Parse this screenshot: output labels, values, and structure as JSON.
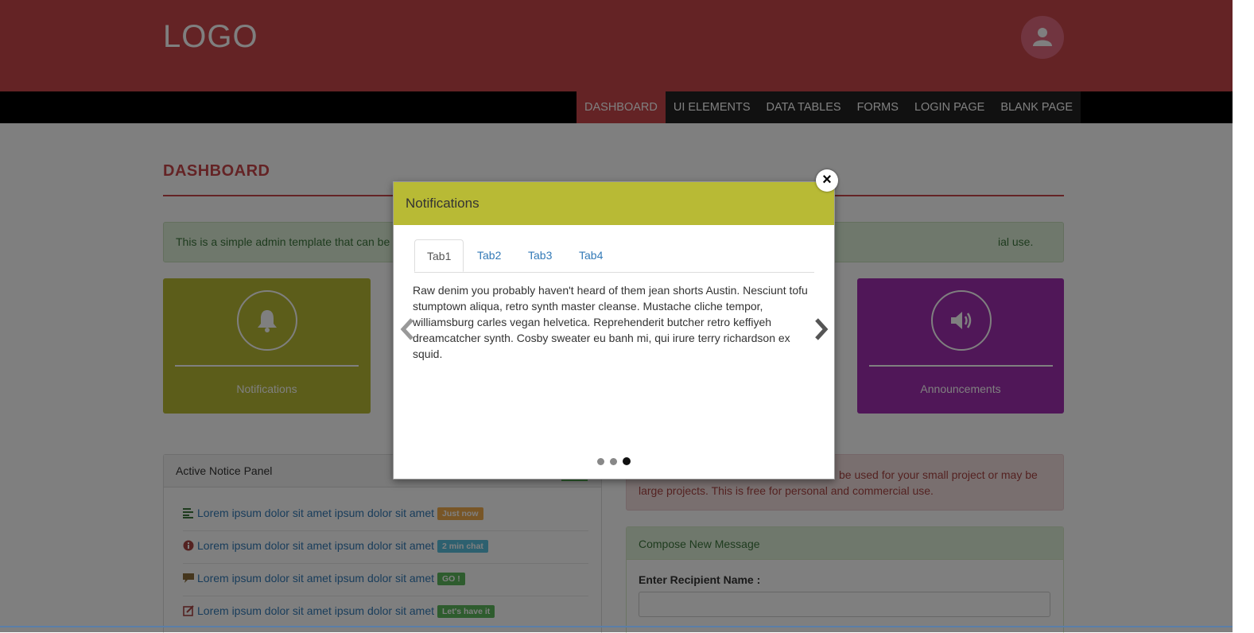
{
  "header": {
    "logo": "LOGO",
    "avatar_icon": "user-icon"
  },
  "nav": {
    "items": [
      "DASHBOARD",
      "UI ELEMENTS",
      "DATA TABLES",
      "FORMS",
      "LOGIN PAGE",
      "BLANK PAGE"
    ],
    "active": "DASHBOARD"
  },
  "page": {
    "title": "DASHBOARD"
  },
  "alert_success": {
    "text_left": "This is a simple admin template that can be",
    "text_right": "ial use."
  },
  "tiles": [
    {
      "label": "Notifications",
      "icon": "bell-icon",
      "color": "#b8ba35"
    },
    {
      "label": "Announcements",
      "icon": "volume-icon",
      "color": "#a12fb0"
    }
  ],
  "notice_panel": {
    "title": "Active Notice Panel",
    "items": [
      {
        "icon": "list-icon",
        "text": "Lorem ipsum dolor sit amet ipsum dolor sit amet",
        "badge": "Just now",
        "badge_color": "#f0ad4e"
      },
      {
        "icon": "info-icon",
        "text": "Lorem ipsum dolor sit amet ipsum dolor sit amet",
        "badge": "2 min chat",
        "badge_color": "#5bc0de"
      },
      {
        "icon": "comment-icon",
        "text": "Lorem ipsum dolor sit amet ipsum dolor sit amet",
        "badge": "GO !",
        "badge_color": "#5cb85c"
      },
      {
        "icon": "edit-icon",
        "text": "Lorem ipsum dolor sit amet ipsum dolor sit amet",
        "badge": "Let's have it",
        "badge_color": "#5cb85c"
      }
    ]
  },
  "alert_danger": {
    "line1": "be used for your small project or may be",
    "line2": "large projects. This is free for personal and commercial use."
  },
  "compose": {
    "title": "Compose New Message",
    "recipient_label": "Enter Recipient Name :",
    "recipient_value": ""
  },
  "modal": {
    "title": "Notifications",
    "close": "×",
    "tabs": [
      "Tab1",
      "Tab2",
      "Tab3",
      "Tab4"
    ],
    "active_tab": "Tab1",
    "content": "Raw denim you probably haven't heard of them jean shorts Austin. Nesciunt tofu stumptown aliqua, retro synth master cleanse. Mustache cliche tempor, williamsburg carles vegan helvetica. Reprehenderit butcher retro keffiyeh dreamcatcher synth. Cosby sweater eu banh mi, qui irure terry richardson ex squid.",
    "carousel": {
      "slides": 3,
      "active_slide": 3
    }
  }
}
